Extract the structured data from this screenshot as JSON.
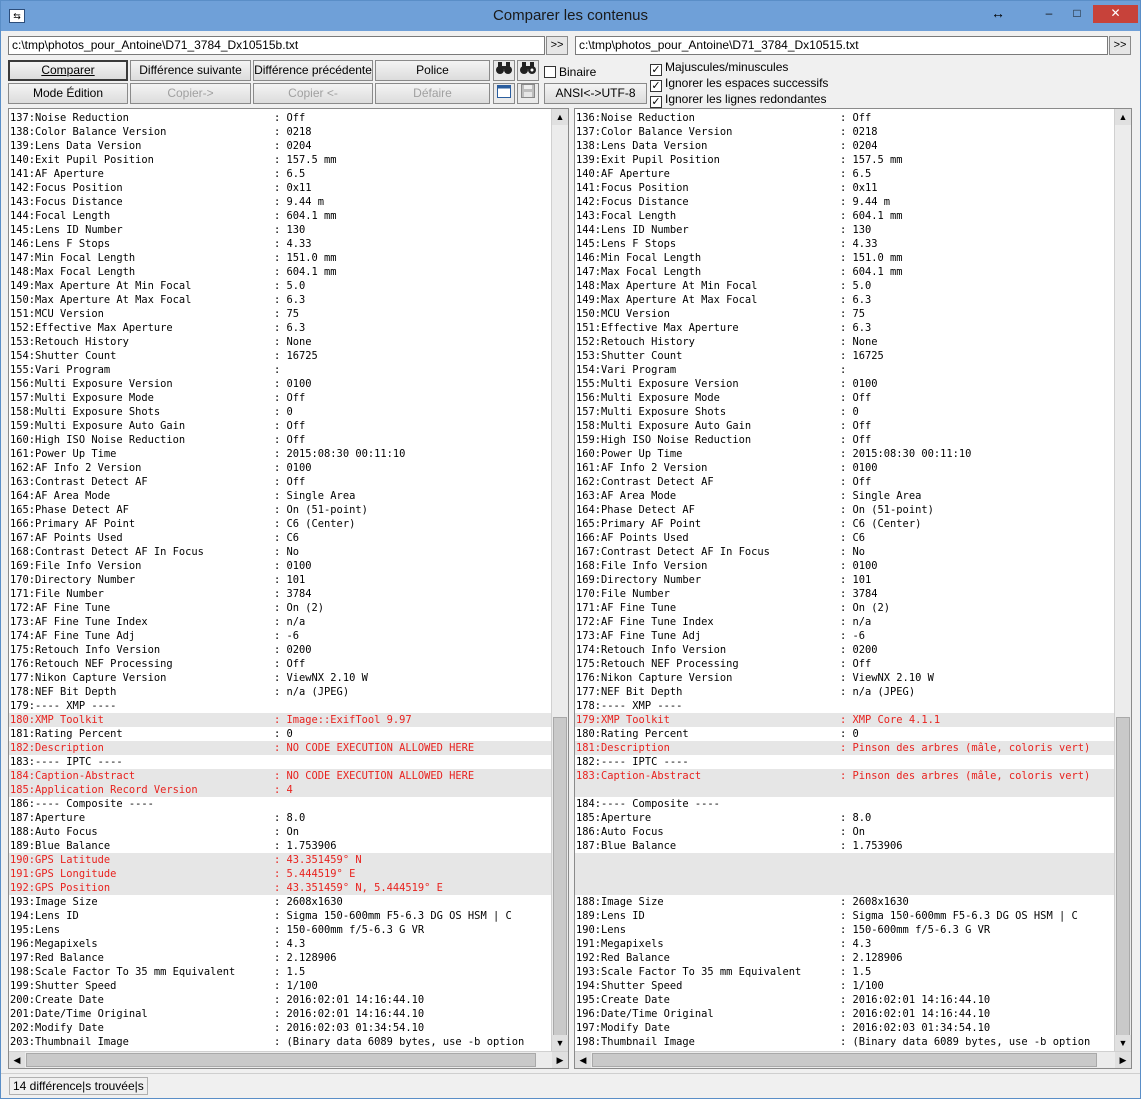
{
  "window": {
    "title": "Comparer les contenus",
    "minimize": "–",
    "maximize": "□",
    "close": "✕",
    "icon": "compare-arrows-icon"
  },
  "left_path": "c:\\tmp\\photos_pour_Antoine\\D71_3784_Dx10515b.txt",
  "right_path": "c:\\tmp\\photos_pour_Antoine\\D71_3784_Dx10515.txt",
  "browse_label": ">>",
  "buttons": {
    "compare": "Comparer",
    "next_diff": "Différence suivante",
    "prev_diff": "Différence précédente",
    "font": "Police",
    "edit_mode": "Mode Édition",
    "copy_right": "Copier->",
    "copy_left": "Copier <-",
    "undo": "Défaire",
    "encoding": "ANSI<->UTF-8"
  },
  "options": {
    "binary": "Binaire",
    "case": "Majuscules/minuscules",
    "spaces": "Ignorer les espaces successifs",
    "dup_lines": "Ignorer les lignes redondantes",
    "binary_checked": false,
    "case_checked": true,
    "spaces_checked": true,
    "dup_lines_checked": true
  },
  "colors": {
    "diff_text": "#e8231f",
    "diff_bg": "#e6e6e6",
    "title_bg": "#6fa0d8"
  },
  "left_lines": [
    {
      "k": "137:Noise Reduction",
      "v": ": Off"
    },
    {
      "k": "138:Color Balance Version",
      "v": ": 0218"
    },
    {
      "k": "139:Lens Data Version",
      "v": ": 0204"
    },
    {
      "k": "140:Exit Pupil Position",
      "v": ": 157.5 mm"
    },
    {
      "k": "141:AF Aperture",
      "v": ": 6.5"
    },
    {
      "k": "142:Focus Position",
      "v": ": 0x11"
    },
    {
      "k": "143:Focus Distance",
      "v": ": 9.44 m"
    },
    {
      "k": "144:Focal Length",
      "v": ": 604.1 mm"
    },
    {
      "k": "145:Lens ID Number",
      "v": ": 130"
    },
    {
      "k": "146:Lens F Stops",
      "v": ": 4.33"
    },
    {
      "k": "147:Min Focal Length",
      "v": ": 151.0 mm"
    },
    {
      "k": "148:Max Focal Length",
      "v": ": 604.1 mm"
    },
    {
      "k": "149:Max Aperture At Min Focal",
      "v": ": 5.0"
    },
    {
      "k": "150:Max Aperture At Max Focal",
      "v": ": 6.3"
    },
    {
      "k": "151:MCU Version",
      "v": ": 75"
    },
    {
      "k": "152:Effective Max Aperture",
      "v": ": 6.3"
    },
    {
      "k": "153:Retouch History",
      "v": ": None"
    },
    {
      "k": "154:Shutter Count",
      "v": ": 16725"
    },
    {
      "k": "155:Vari Program",
      "v": ":"
    },
    {
      "k": "156:Multi Exposure Version",
      "v": ": 0100"
    },
    {
      "k": "157:Multi Exposure Mode",
      "v": ": Off"
    },
    {
      "k": "158:Multi Exposure Shots",
      "v": ": 0"
    },
    {
      "k": "159:Multi Exposure Auto Gain",
      "v": ": Off"
    },
    {
      "k": "160:High ISO Noise Reduction",
      "v": ": Off"
    },
    {
      "k": "161:Power Up Time",
      "v": ": 2015:08:30 00:11:10"
    },
    {
      "k": "162:AF Info 2 Version",
      "v": ": 0100"
    },
    {
      "k": "163:Contrast Detect AF",
      "v": ": Off"
    },
    {
      "k": "164:AF Area Mode",
      "v": ": Single Area"
    },
    {
      "k": "165:Phase Detect AF",
      "v": ": On (51-point)"
    },
    {
      "k": "166:Primary AF Point",
      "v": ": C6 (Center)"
    },
    {
      "k": "167:AF Points Used",
      "v": ": C6"
    },
    {
      "k": "168:Contrast Detect AF In Focus",
      "v": ": No"
    },
    {
      "k": "169:File Info Version",
      "v": ": 0100"
    },
    {
      "k": "170:Directory Number",
      "v": ": 101"
    },
    {
      "k": "171:File Number",
      "v": ": 3784"
    },
    {
      "k": "172:AF Fine Tune",
      "v": ": On (2)"
    },
    {
      "k": "173:AF Fine Tune Index",
      "v": ": n/a"
    },
    {
      "k": "174:AF Fine Tune Adj",
      "v": ": -6"
    },
    {
      "k": "175:Retouch Info Version",
      "v": ": 0200"
    },
    {
      "k": "176:Retouch NEF Processing",
      "v": ": Off"
    },
    {
      "k": "177:Nikon Capture Version",
      "v": ": ViewNX 2.10 W"
    },
    {
      "k": "178:NEF Bit Depth",
      "v": ": n/a (JPEG)"
    },
    {
      "k": "179:---- XMP ----",
      "v": ""
    },
    {
      "k": "180:XMP Toolkit",
      "v": ": Image::ExifTool 9.97",
      "d": true
    },
    {
      "k": "181:Rating Percent",
      "v": ": 0"
    },
    {
      "k": "182:Description",
      "v": ": NO CODE EXECUTION ALLOWED HERE",
      "d": true
    },
    {
      "k": "183:---- IPTC ----",
      "v": ""
    },
    {
      "k": "184:Caption-Abstract",
      "v": ": NO CODE EXECUTION ALLOWED HERE",
      "d": true
    },
    {
      "k": "185:Application Record Version",
      "v": ": 4",
      "d": true
    },
    {
      "k": "186:---- Composite ----",
      "v": ""
    },
    {
      "k": "187:Aperture",
      "v": ": 8.0"
    },
    {
      "k": "188:Auto Focus",
      "v": ": On"
    },
    {
      "k": "189:Blue Balance",
      "v": ": 1.753906"
    },
    {
      "k": "190:GPS Latitude",
      "v": ": 43.351459° N",
      "d": true
    },
    {
      "k": "191:GPS Longitude",
      "v": ": 5.444519° E",
      "d": true
    },
    {
      "k": "192:GPS Position",
      "v": ": 43.351459° N, 5.444519° E",
      "d": true
    },
    {
      "k": "193:Image Size",
      "v": ": 2608x1630"
    },
    {
      "k": "194:Lens ID",
      "v": ": Sigma 150-600mm F5-6.3 DG OS HSM | C"
    },
    {
      "k": "195:Lens",
      "v": ": 150-600mm f/5-6.3 G VR"
    },
    {
      "k": "196:Megapixels",
      "v": ": 4.3"
    },
    {
      "k": "197:Red Balance",
      "v": ": 2.128906"
    },
    {
      "k": "198:Scale Factor To 35 mm Equivalent",
      "v": ": 1.5"
    },
    {
      "k": "199:Shutter Speed",
      "v": ": 1/100"
    },
    {
      "k": "200:Create Date",
      "v": ": 2016:02:01 14:16:44.10"
    },
    {
      "k": "201:Date/Time Original",
      "v": ": 2016:02:01 14:16:44.10"
    },
    {
      "k": "202:Modify Date",
      "v": ": 2016:02:03 01:34:54.10"
    },
    {
      "k": "203:Thumbnail Image",
      "v": ": (Binary data 6089 bytes, use -b option"
    }
  ],
  "right_lines": [
    {
      "k": "136:Noise Reduction",
      "v": ": Off"
    },
    {
      "k": "137:Color Balance Version",
      "v": ": 0218"
    },
    {
      "k": "138:Lens Data Version",
      "v": ": 0204"
    },
    {
      "k": "139:Exit Pupil Position",
      "v": ": 157.5 mm"
    },
    {
      "k": "140:AF Aperture",
      "v": ": 6.5"
    },
    {
      "k": "141:Focus Position",
      "v": ": 0x11"
    },
    {
      "k": "142:Focus Distance",
      "v": ": 9.44 m"
    },
    {
      "k": "143:Focal Length",
      "v": ": 604.1 mm"
    },
    {
      "k": "144:Lens ID Number",
      "v": ": 130"
    },
    {
      "k": "145:Lens F Stops",
      "v": ": 4.33"
    },
    {
      "k": "146:Min Focal Length",
      "v": ": 151.0 mm"
    },
    {
      "k": "147:Max Focal Length",
      "v": ": 604.1 mm"
    },
    {
      "k": "148:Max Aperture At Min Focal",
      "v": ": 5.0"
    },
    {
      "k": "149:Max Aperture At Max Focal",
      "v": ": 6.3"
    },
    {
      "k": "150:MCU Version",
      "v": ": 75"
    },
    {
      "k": "151:Effective Max Aperture",
      "v": ": 6.3"
    },
    {
      "k": "152:Retouch History",
      "v": ": None"
    },
    {
      "k": "153:Shutter Count",
      "v": ": 16725"
    },
    {
      "k": "154:Vari Program",
      "v": ":"
    },
    {
      "k": "155:Multi Exposure Version",
      "v": ": 0100"
    },
    {
      "k": "156:Multi Exposure Mode",
      "v": ": Off"
    },
    {
      "k": "157:Multi Exposure Shots",
      "v": ": 0"
    },
    {
      "k": "158:Multi Exposure Auto Gain",
      "v": ": Off"
    },
    {
      "k": "159:High ISO Noise Reduction",
      "v": ": Off"
    },
    {
      "k": "160:Power Up Time",
      "v": ": 2015:08:30 00:11:10"
    },
    {
      "k": "161:AF Info 2 Version",
      "v": ": 0100"
    },
    {
      "k": "162:Contrast Detect AF",
      "v": ": Off"
    },
    {
      "k": "163:AF Area Mode",
      "v": ": Single Area"
    },
    {
      "k": "164:Phase Detect AF",
      "v": ": On (51-point)"
    },
    {
      "k": "165:Primary AF Point",
      "v": ": C6 (Center)"
    },
    {
      "k": "166:AF Points Used",
      "v": ": C6"
    },
    {
      "k": "167:Contrast Detect AF In Focus",
      "v": ": No"
    },
    {
      "k": "168:File Info Version",
      "v": ": 0100"
    },
    {
      "k": "169:Directory Number",
      "v": ": 101"
    },
    {
      "k": "170:File Number",
      "v": ": 3784"
    },
    {
      "k": "171:AF Fine Tune",
      "v": ": On (2)"
    },
    {
      "k": "172:AF Fine Tune Index",
      "v": ": n/a"
    },
    {
      "k": "173:AF Fine Tune Adj",
      "v": ": -6"
    },
    {
      "k": "174:Retouch Info Version",
      "v": ": 0200"
    },
    {
      "k": "175:Retouch NEF Processing",
      "v": ": Off"
    },
    {
      "k": "176:Nikon Capture Version",
      "v": ": ViewNX 2.10 W"
    },
    {
      "k": "177:NEF Bit Depth",
      "v": ": n/a (JPEG)"
    },
    {
      "k": "178:---- XMP ----",
      "v": ""
    },
    {
      "k": "179:XMP Toolkit",
      "v": ": XMP Core 4.1.1",
      "d": true
    },
    {
      "k": "180:Rating Percent",
      "v": ": 0"
    },
    {
      "k": "181:Description",
      "v": ": Pinson des arbres (mâle, coloris vert)",
      "d": true
    },
    {
      "k": "182:---- IPTC ----",
      "v": ""
    },
    {
      "k": "183:Caption-Abstract",
      "v": ": Pinson des arbres (mâle, coloris vert)",
      "d": true
    },
    {
      "k": "",
      "v": "",
      "b": true
    },
    {
      "k": "184:---- Composite ----",
      "v": ""
    },
    {
      "k": "185:Aperture",
      "v": ": 8.0"
    },
    {
      "k": "186:Auto Focus",
      "v": ": On"
    },
    {
      "k": "187:Blue Balance",
      "v": ": 1.753906"
    },
    {
      "k": "",
      "v": "",
      "b": true
    },
    {
      "k": "",
      "v": "",
      "b": true
    },
    {
      "k": "",
      "v": "",
      "b": true
    },
    {
      "k": "188:Image Size",
      "v": ": 2608x1630"
    },
    {
      "k": "189:Lens ID",
      "v": ": Sigma 150-600mm F5-6.3 DG OS HSM | C"
    },
    {
      "k": "190:Lens",
      "v": ": 150-600mm f/5-6.3 G VR"
    },
    {
      "k": "191:Megapixels",
      "v": ": 4.3"
    },
    {
      "k": "192:Red Balance",
      "v": ": 2.128906"
    },
    {
      "k": "193:Scale Factor To 35 mm Equivalent",
      "v": ": 1.5"
    },
    {
      "k": "194:Shutter Speed",
      "v": ": 1/100"
    },
    {
      "k": "195:Create Date",
      "v": ": 2016:02:01 14:16:44.10"
    },
    {
      "k": "196:Date/Time Original",
      "v": ": 2016:02:01 14:16:44.10"
    },
    {
      "k": "197:Modify Date",
      "v": ": 2016:02:03 01:34:54.10"
    },
    {
      "k": "198:Thumbnail Image",
      "v": ": (Binary data 6089 bytes, use -b option"
    }
  ],
  "status": "14 différence|s trouvée|s"
}
